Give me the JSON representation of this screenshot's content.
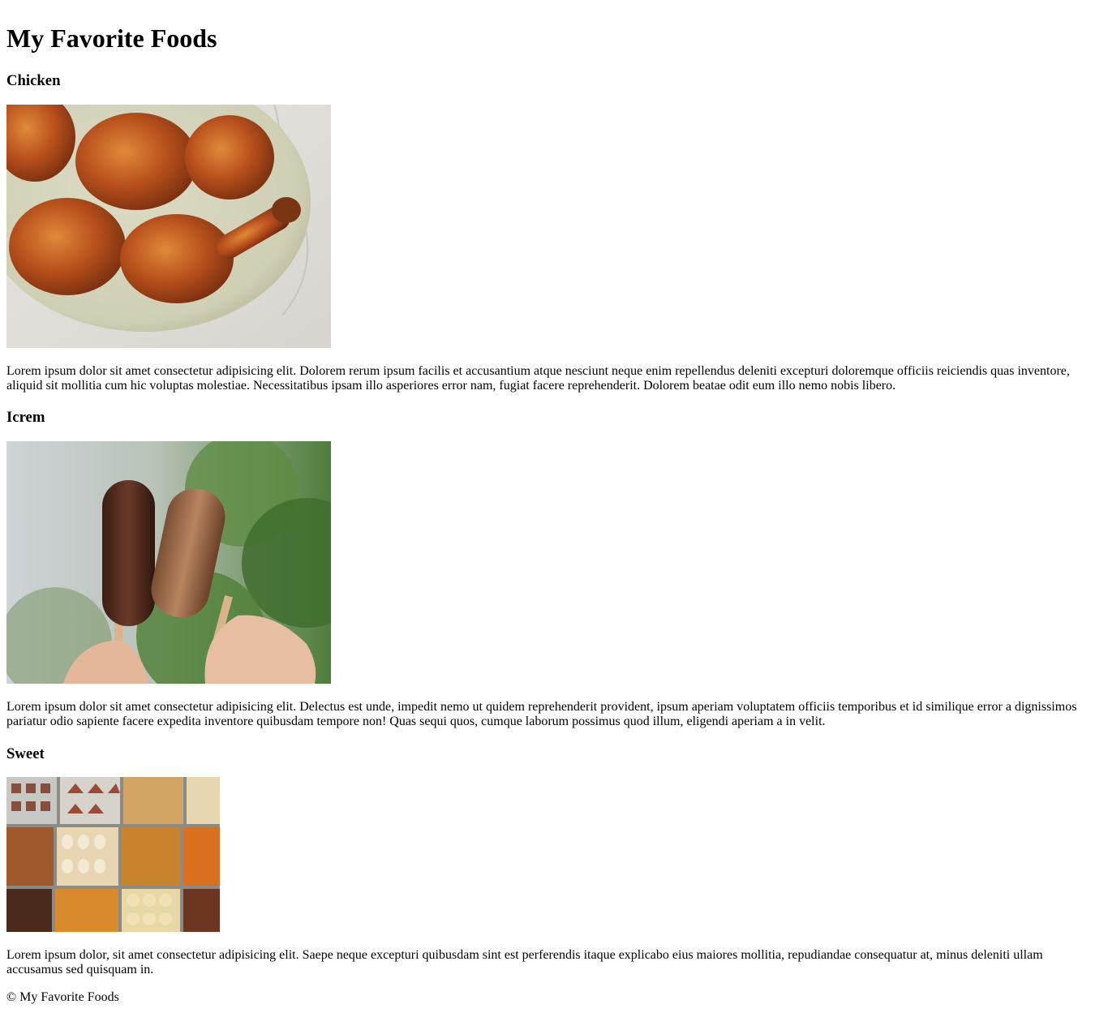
{
  "page": {
    "title": "My Favorite Foods"
  },
  "sections": [
    {
      "heading": "Chicken",
      "image_subject": "fried-chicken-photo",
      "text": "Lorem ipsum dolor sit amet consectetur adipisicing elit. Dolorem rerum ipsum facilis et accusantium atque nesciunt neque enim repellendus deleniti excepturi doloremque officiis reiciendis quas inventore, aliquid sit mollitia cum hic voluptas molestiae. Necessitatibus ipsam illo asperiores error nam, fugiat facere reprehenderit. Dolorem beatae odit eum illo nemo nobis libero."
    },
    {
      "heading": "Icrem",
      "image_subject": "ice-cream-bars-photo",
      "text": "Lorem ipsum dolor sit amet consectetur adipisicing elit. Delectus est unde, impedit nemo ut quidem reprehenderit provident, ipsum aperiam voluptatem officiis temporibus et id similique error a dignissimos pariatur odio sapiente facere expedita inventore quibusdam tempore non! Quas sequi quos, cumque laborum possimus quod illum, eligendi aperiam a in velit."
    },
    {
      "heading": "Sweet",
      "image_subject": "sweets-trays-photo",
      "text": "Lorem ipsum dolor, sit amet consectetur adipisicing elit. Saepe neque excepturi quibusdam sint est perferendis itaque explicabo eius maiores mollitia, repudiandae consequatur at, minus deleniti ullam accusamus sed quisquam in."
    }
  ],
  "footer": {
    "text": "© My Favorite Foods"
  }
}
